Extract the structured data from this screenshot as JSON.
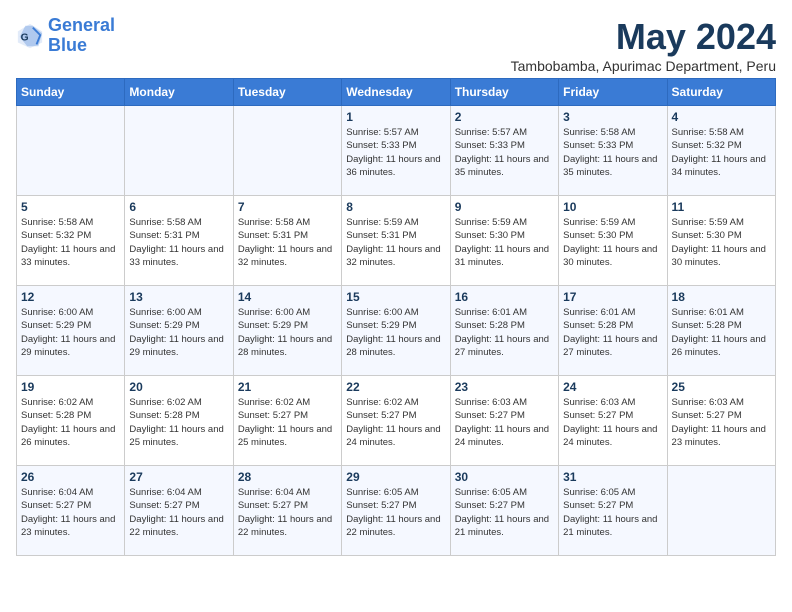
{
  "logo": {
    "line1": "General",
    "line2": "Blue"
  },
  "title": "May 2024",
  "subtitle": "Tambobamba, Apurimac Department, Peru",
  "days_of_week": [
    "Sunday",
    "Monday",
    "Tuesday",
    "Wednesday",
    "Thursday",
    "Friday",
    "Saturday"
  ],
  "weeks": [
    [
      {
        "day": "",
        "info": ""
      },
      {
        "day": "",
        "info": ""
      },
      {
        "day": "",
        "info": ""
      },
      {
        "day": "1",
        "info": "Sunrise: 5:57 AM\nSunset: 5:33 PM\nDaylight: 11 hours\nand 36 minutes."
      },
      {
        "day": "2",
        "info": "Sunrise: 5:57 AM\nSunset: 5:33 PM\nDaylight: 11 hours\nand 35 minutes."
      },
      {
        "day": "3",
        "info": "Sunrise: 5:58 AM\nSunset: 5:33 PM\nDaylight: 11 hours\nand 35 minutes."
      },
      {
        "day": "4",
        "info": "Sunrise: 5:58 AM\nSunset: 5:32 PM\nDaylight: 11 hours\nand 34 minutes."
      }
    ],
    [
      {
        "day": "5",
        "info": "Sunrise: 5:58 AM\nSunset: 5:32 PM\nDaylight: 11 hours\nand 33 minutes."
      },
      {
        "day": "6",
        "info": "Sunrise: 5:58 AM\nSunset: 5:31 PM\nDaylight: 11 hours\nand 33 minutes."
      },
      {
        "day": "7",
        "info": "Sunrise: 5:58 AM\nSunset: 5:31 PM\nDaylight: 11 hours\nand 32 minutes."
      },
      {
        "day": "8",
        "info": "Sunrise: 5:59 AM\nSunset: 5:31 PM\nDaylight: 11 hours\nand 32 minutes."
      },
      {
        "day": "9",
        "info": "Sunrise: 5:59 AM\nSunset: 5:30 PM\nDaylight: 11 hours\nand 31 minutes."
      },
      {
        "day": "10",
        "info": "Sunrise: 5:59 AM\nSunset: 5:30 PM\nDaylight: 11 hours\nand 30 minutes."
      },
      {
        "day": "11",
        "info": "Sunrise: 5:59 AM\nSunset: 5:30 PM\nDaylight: 11 hours\nand 30 minutes."
      }
    ],
    [
      {
        "day": "12",
        "info": "Sunrise: 6:00 AM\nSunset: 5:29 PM\nDaylight: 11 hours\nand 29 minutes."
      },
      {
        "day": "13",
        "info": "Sunrise: 6:00 AM\nSunset: 5:29 PM\nDaylight: 11 hours\nand 29 minutes."
      },
      {
        "day": "14",
        "info": "Sunrise: 6:00 AM\nSunset: 5:29 PM\nDaylight: 11 hours\nand 28 minutes."
      },
      {
        "day": "15",
        "info": "Sunrise: 6:00 AM\nSunset: 5:29 PM\nDaylight: 11 hours\nand 28 minutes."
      },
      {
        "day": "16",
        "info": "Sunrise: 6:01 AM\nSunset: 5:28 PM\nDaylight: 11 hours\nand 27 minutes."
      },
      {
        "day": "17",
        "info": "Sunrise: 6:01 AM\nSunset: 5:28 PM\nDaylight: 11 hours\nand 27 minutes."
      },
      {
        "day": "18",
        "info": "Sunrise: 6:01 AM\nSunset: 5:28 PM\nDaylight: 11 hours\nand 26 minutes."
      }
    ],
    [
      {
        "day": "19",
        "info": "Sunrise: 6:02 AM\nSunset: 5:28 PM\nDaylight: 11 hours\nand 26 minutes."
      },
      {
        "day": "20",
        "info": "Sunrise: 6:02 AM\nSunset: 5:28 PM\nDaylight: 11 hours\nand 25 minutes."
      },
      {
        "day": "21",
        "info": "Sunrise: 6:02 AM\nSunset: 5:27 PM\nDaylight: 11 hours\nand 25 minutes."
      },
      {
        "day": "22",
        "info": "Sunrise: 6:02 AM\nSunset: 5:27 PM\nDaylight: 11 hours\nand 24 minutes."
      },
      {
        "day": "23",
        "info": "Sunrise: 6:03 AM\nSunset: 5:27 PM\nDaylight: 11 hours\nand 24 minutes."
      },
      {
        "day": "24",
        "info": "Sunrise: 6:03 AM\nSunset: 5:27 PM\nDaylight: 11 hours\nand 24 minutes."
      },
      {
        "day": "25",
        "info": "Sunrise: 6:03 AM\nSunset: 5:27 PM\nDaylight: 11 hours\nand 23 minutes."
      }
    ],
    [
      {
        "day": "26",
        "info": "Sunrise: 6:04 AM\nSunset: 5:27 PM\nDaylight: 11 hours\nand 23 minutes."
      },
      {
        "day": "27",
        "info": "Sunrise: 6:04 AM\nSunset: 5:27 PM\nDaylight: 11 hours\nand 22 minutes."
      },
      {
        "day": "28",
        "info": "Sunrise: 6:04 AM\nSunset: 5:27 PM\nDaylight: 11 hours\nand 22 minutes."
      },
      {
        "day": "29",
        "info": "Sunrise: 6:05 AM\nSunset: 5:27 PM\nDaylight: 11 hours\nand 22 minutes."
      },
      {
        "day": "30",
        "info": "Sunrise: 6:05 AM\nSunset: 5:27 PM\nDaylight: 11 hours\nand 21 minutes."
      },
      {
        "day": "31",
        "info": "Sunrise: 6:05 AM\nSunset: 5:27 PM\nDaylight: 11 hours\nand 21 minutes."
      },
      {
        "day": "",
        "info": ""
      }
    ]
  ]
}
